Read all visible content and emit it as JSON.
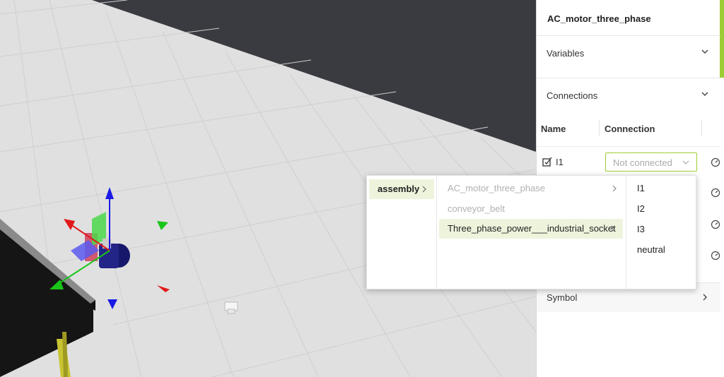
{
  "panel": {
    "title": "AC_motor_three_phase",
    "sections": {
      "variables": "Variables",
      "connections": "Connections",
      "symbol": "Symbol"
    },
    "table": {
      "col_name": "Name",
      "col_connection": "Connection",
      "rows": [
        {
          "name": "I1",
          "connection": "Not connected"
        }
      ]
    }
  },
  "dropdown": {
    "col1": [
      {
        "label": "assembly",
        "selected": true,
        "has_children": true
      }
    ],
    "col2": [
      {
        "label": "AC_motor_three_phase",
        "disabled": true,
        "has_children": true
      },
      {
        "label": "conveyor_belt",
        "disabled": true,
        "has_children": false
      },
      {
        "label": "Three_phase_power___industrial_socket",
        "selected": true,
        "has_children": true
      }
    ],
    "col3": [
      "I1",
      "I2",
      "I3",
      "neutral"
    ]
  },
  "colors": {
    "accent": "#9ccd34",
    "floor": "#e0e0e0",
    "background": "#3a3b40",
    "gizmo_x": "#e01919",
    "gizmo_y": "#19c519",
    "gizmo_z": "#1a1ae6"
  },
  "icons": [
    "chevron-down-icon",
    "chevron-right-icon",
    "edit-checkbox-icon",
    "gauge-icon"
  ]
}
